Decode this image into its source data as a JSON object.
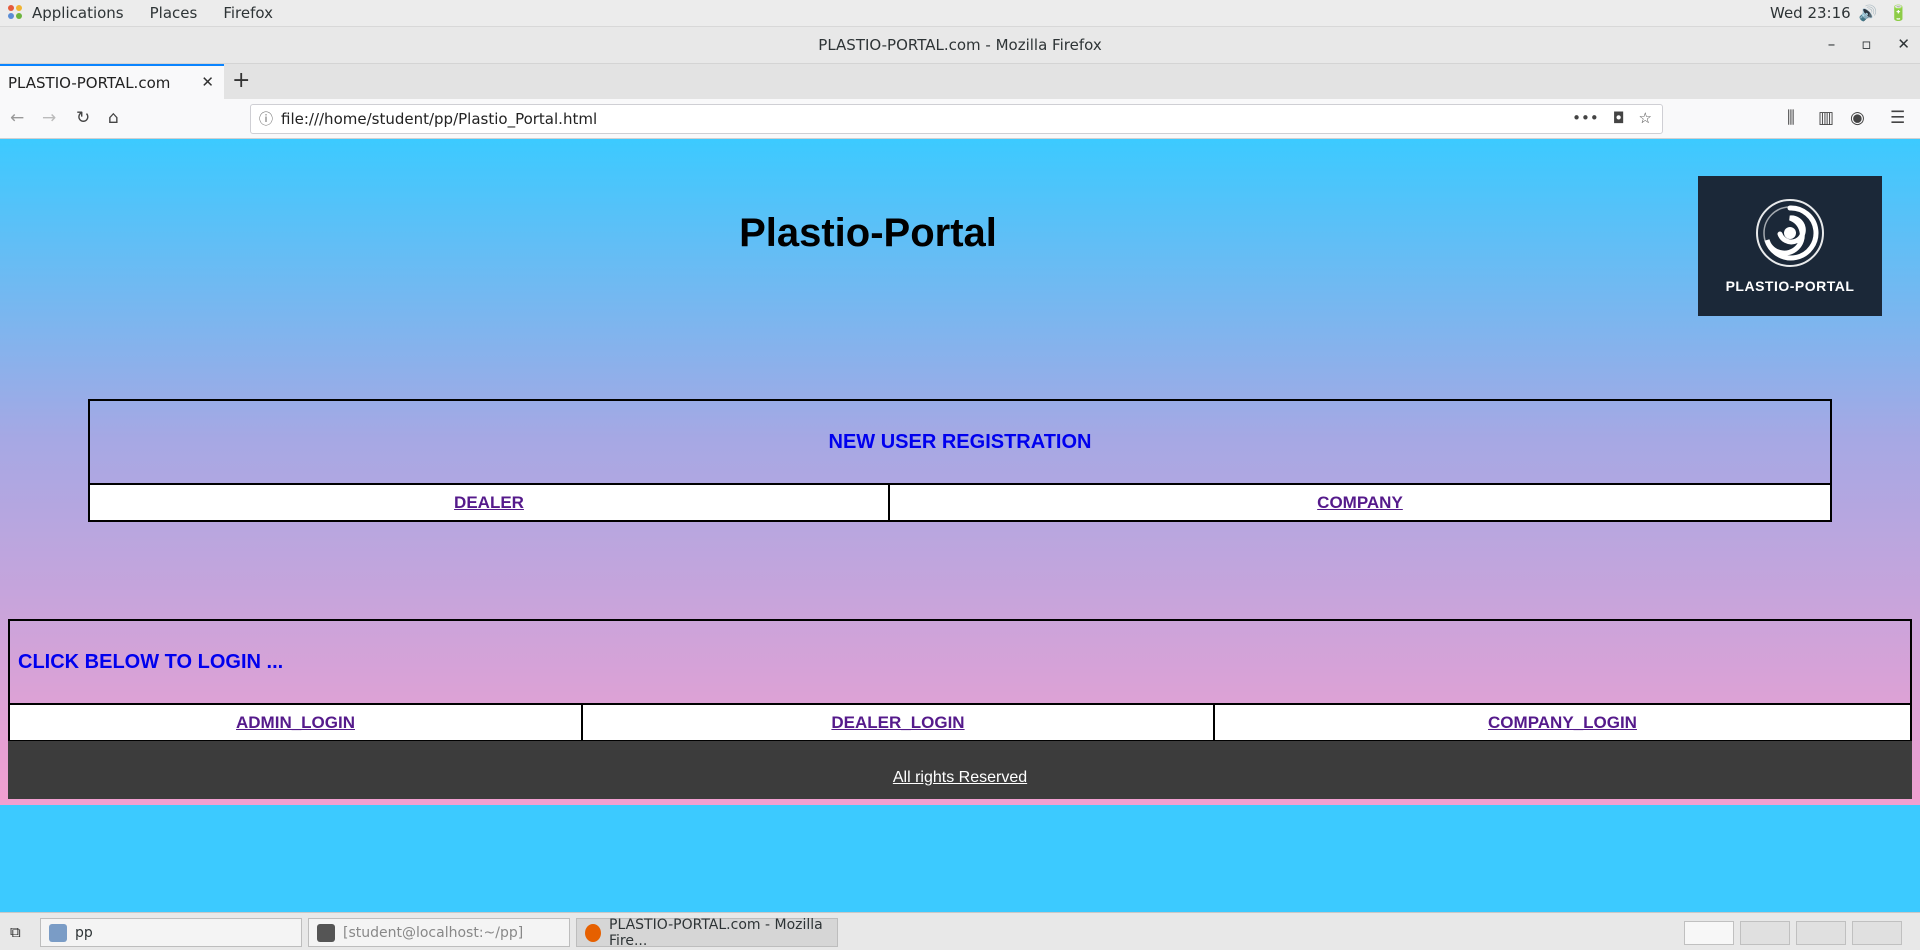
{
  "topbar": {
    "applications": "Applications",
    "places": "Places",
    "firefox": "Firefox",
    "clock": "Wed 23:16"
  },
  "window": {
    "title": "PLASTIO-PORTAL.com - Mozilla Firefox"
  },
  "browser": {
    "tab_title": "PLASTIO-PORTAL.com",
    "url": "file:///home/student/pp/Plastio_Portal.html"
  },
  "page": {
    "site_title": "Plastio-Portal",
    "logo_text": "PLASTIO-PORTAL",
    "registration": {
      "header": "NEW USER REGISTRATION",
      "dealer": "DEALER",
      "company": "COMPANY"
    },
    "login": {
      "header": "CLICK BELOW TO LOGIN ...",
      "admin": "ADMIN_LOGIN",
      "dealer": "DEALER_LOGIN",
      "company": "COMPANY_LOGIN"
    },
    "footer": "All rights Reserved",
    "colors": {
      "gradient_top": "#3ccaff",
      "gradient_bottom": "#f29fd0",
      "header_text": "#0000ee",
      "link_text": "#551a8b",
      "footer_bg": "#3c3c3c",
      "logo_bg": "#1b2838"
    }
  },
  "taskbar": {
    "items": [
      {
        "label": "pp",
        "icon": "file-manager-icon"
      },
      {
        "label": "[student@localhost:~/pp]",
        "icon": "terminal-icon"
      },
      {
        "label": "PLASTIO-PORTAL.com - Mozilla Fire...",
        "icon": "firefox-icon"
      }
    ]
  }
}
